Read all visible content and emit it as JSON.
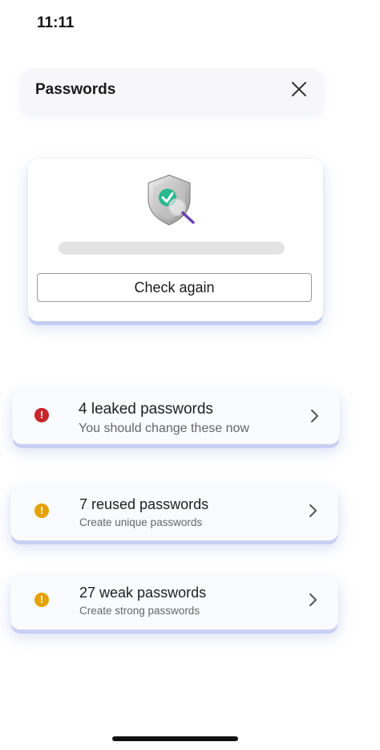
{
  "status_bar": {
    "time": "11:11"
  },
  "header": {
    "title": "Passwords",
    "close_icon": "close-icon"
  },
  "check_card": {
    "shield_icon": "shield-check-magnifier-icon",
    "progress_fraction": 0,
    "button_label": "Check again"
  },
  "issues": [
    {
      "title": "4 leaked passwords",
      "subtitle": "You should change these now",
      "severity": "error",
      "color": "#c8262b",
      "icon": "error-icon"
    },
    {
      "title": "7 reused passwords",
      "subtitle": "Create unique passwords",
      "severity": "warning",
      "color": "#e6a100",
      "icon": "warning-icon"
    },
    {
      "title": "27 weak passwords",
      "subtitle": "Create strong passwords",
      "severity": "warning",
      "color": "#e6a100",
      "icon": "warning-icon"
    }
  ]
}
